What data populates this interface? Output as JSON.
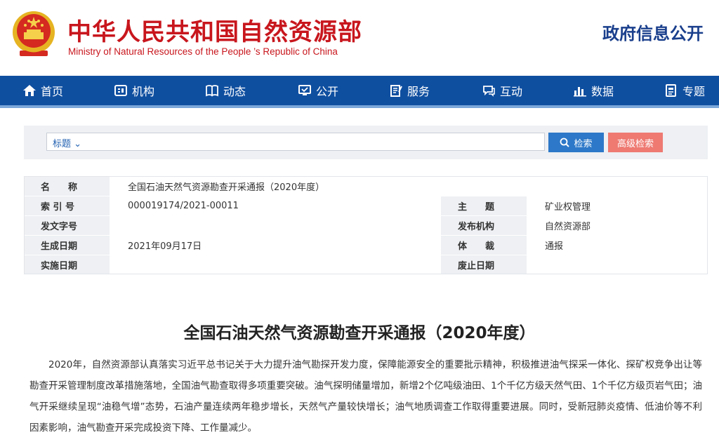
{
  "header": {
    "site_name_cn": "中华人民共和国自然资源部",
    "site_name_en": "Ministry of Natural Resources of the People ’s Republic of China",
    "gov_info": "政府信息公开"
  },
  "nav": {
    "items": [
      {
        "label": "首页",
        "icon": "home-icon"
      },
      {
        "label": "机构",
        "icon": "org-icon"
      },
      {
        "label": "动态",
        "icon": "book-icon"
      },
      {
        "label": "公开",
        "icon": "monitor-icon"
      },
      {
        "label": "服务",
        "icon": "edit-icon"
      },
      {
        "label": "互动",
        "icon": "chat-icon"
      },
      {
        "label": "数据",
        "icon": "bar-chart-icon"
      },
      {
        "label": "专题",
        "icon": "document-icon"
      }
    ]
  },
  "search": {
    "type_label": "标题 ⌄",
    "value": "",
    "search_button": "检索",
    "advanced_button": "高级检索"
  },
  "meta": {
    "name_label": "名　　称",
    "name_value": "全国石油天然气资源勘查开采通报（2020年度）",
    "index_label": "索 引 号",
    "index_value": "000019174/2021-00011",
    "subject_label": "主　　题",
    "subject_value": "矿业权管理",
    "doc_no_label": "发文字号",
    "doc_no_value": "",
    "issuer_label": "发布机构",
    "issuer_value": "自然资源部",
    "date_label": "生成日期",
    "date_value": "2021年09月17日",
    "genre_label": "体　　裁",
    "genre_value": "通报",
    "effective_label": "实施日期",
    "effective_value": "",
    "repeal_label": "废止日期",
    "repeal_value": ""
  },
  "article": {
    "title": "全国石油天然气资源勘查开采通报（2020年度）",
    "paragraph": "2020年，自然资源部认真落实习近平总书记关于大力提升油气勘探开发力度，保障能源安全的重要批示精神，积极推进油气探采一体化、探矿权竞争出让等勘查开采管理制度改革措施落地，全国油气勘查取得多项重要突破。油气探明储量增加，新增2个亿吨级油田、1个千亿方级天然气田、1个千亿方级页岩气田；油气开采继续呈现“油稳气增”态势，石油产量连续两年稳步增长，天然气产量较快增长；油气地质调查工作取得重要进展。同时，受新冠肺炎疫情、低油价等不利因素影响，油气勘查开采完成投资下降、工作量减少。"
  },
  "colors": {
    "brand_red": "#c8161d",
    "nav_blue": "#0f4fa0",
    "search_blue": "#2d78c8",
    "advanced_pink": "#ee7a72",
    "gov_info_blue": "#1a3f8c"
  }
}
